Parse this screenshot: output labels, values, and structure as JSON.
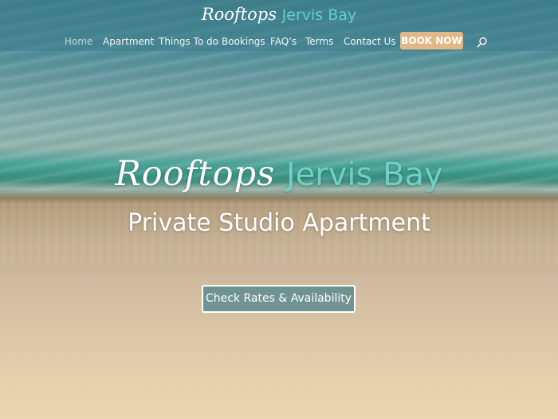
{
  "site": {
    "logo_script": "Rooftops",
    "logo_accent": "Jervis Bay"
  },
  "nav": {
    "items": [
      {
        "label": "Home",
        "active": true
      },
      {
        "label": "Apartment"
      },
      {
        "label": "Things To do"
      },
      {
        "label": "Bookings"
      },
      {
        "label": "FAQ’s"
      },
      {
        "label": "Terms"
      },
      {
        "label": "Contact Us"
      }
    ],
    "book_now_label": "BOOK NOW",
    "search_icon": "search-icon"
  },
  "hero": {
    "title_script": "Rooftops",
    "title_accent": "Jervis Bay",
    "subtitle": "Private Studio Apartment",
    "cta_label": "Check Rates & Availability"
  },
  "colors": {
    "accent_teal": "#5fd1cc",
    "book_button": "#e2b888",
    "header_overlay": "#407e8c"
  }
}
